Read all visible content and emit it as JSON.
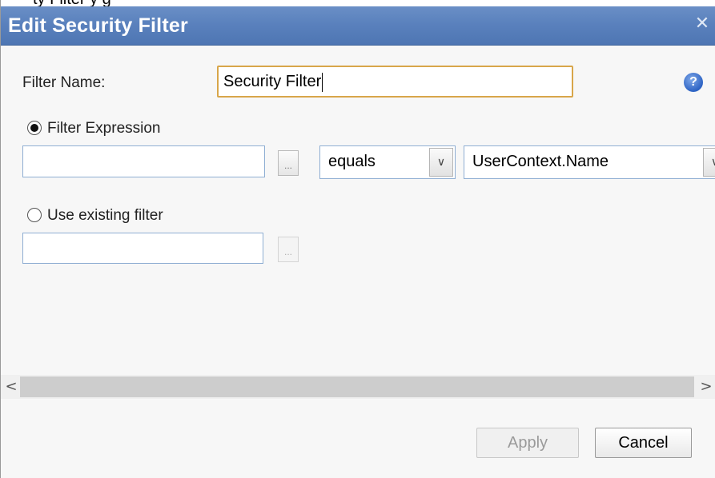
{
  "page_peek_text": "ty Filter                                                        y   g",
  "dialog": {
    "title": "Edit Security Filter",
    "close_glyph": "✕"
  },
  "filter_name": {
    "label": "Filter Name:",
    "value": "Security Filter"
  },
  "help_icon": "?",
  "options": {
    "filter_expression": {
      "label": "Filter Expression",
      "selected": true,
      "field_value": "",
      "browse_label": "...",
      "operator": "equals",
      "operand": "UserContext.Name",
      "dropdown_glyph": "∨"
    },
    "existing_filter": {
      "label": "Use existing filter",
      "selected": false,
      "field_value": "",
      "browse_label": "..."
    }
  },
  "scrollbar": {
    "left_arrow": "<",
    "right_arrow": ">"
  },
  "buttons": {
    "apply": "Apply",
    "cancel": "Cancel"
  }
}
